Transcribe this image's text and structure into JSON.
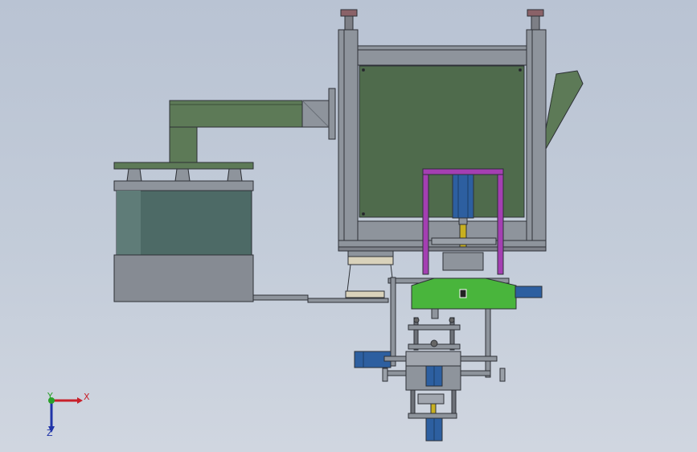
{
  "viewport": {
    "background_top": "#b9c3d3",
    "background_bottom": "#d0d6e0"
  },
  "colors": {
    "frame_gray": "#8e949c",
    "frame_edge": "#2d3036",
    "panel_green": "#4f6b4c",
    "arm_green": "#5d7a57",
    "drum_teal": "#4d6a66",
    "drum_gray": "#868b93",
    "magenta": "#a43fb2",
    "bright_green": "#49b53c",
    "cylinder_blue": "#2d5fa0",
    "rod_yellow": "#c8b020",
    "light_tan": "#d9d2bb"
  },
  "axis_triad": {
    "x_label": "X",
    "y_label": "Y",
    "z_label": "Z",
    "x_color": "#c8202a",
    "y_color": "#2aa02a",
    "z_color": "#1f33a8"
  }
}
